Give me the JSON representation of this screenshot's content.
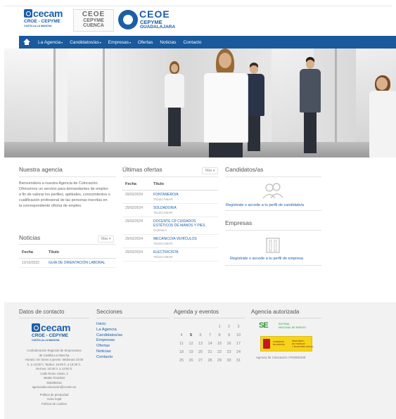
{
  "brand": {
    "cecam": {
      "name": "cecam",
      "line1": "CROE - CEPYME",
      "line2": "CASTILLA-LA MANCHA"
    },
    "cuenca": {
      "line1": "CEOE",
      "line2": "CEPYME",
      "line3": "CUENCA"
    },
    "guadalajara": {
      "line1": "CEOE",
      "line2": "CEPYME",
      "line3": "GUADALAJARA"
    }
  },
  "nav": {
    "home_icon": "home-icon",
    "items": [
      {
        "label": "La Agencia",
        "dropdown": true
      },
      {
        "label": "Candidatos/as",
        "dropdown": true
      },
      {
        "label": "Empresas",
        "dropdown": true
      },
      {
        "label": "Ofertas",
        "dropdown": false
      },
      {
        "label": "Noticias",
        "dropdown": false
      },
      {
        "label": "Contacto",
        "dropdown": false
      }
    ],
    "caret": "▾"
  },
  "agency": {
    "title": "Nuestra agencia",
    "text": "Bienvenido/a a nuestra Agencia de Colocación. Ofrecemos un servicio para demandantes de empleo a fin de valorar los perfiles, aptitudes, conocimientos o cualificación profesional de las personas inscritas en la correspondiente oficina de empleo."
  },
  "news": {
    "title": "Noticias",
    "more": "Más",
    "headers": [
      "Fecha",
      "Título"
    ],
    "rows": [
      {
        "date": "13/10/2022",
        "title": "GUÍA DE ORIENTACIÓN LABORAL"
      }
    ]
  },
  "offers": {
    "title": "Últimas ofertas",
    "more": "Más",
    "headers": [
      "Fecha",
      "Título"
    ],
    "rows": [
      {
        "date": "29/02/2024",
        "title": "FONTANERO/A",
        "location": "TELECAMAR"
      },
      {
        "date": "29/02/2024",
        "title": "SOLDADOR/A",
        "location": "TELECAMAR"
      },
      {
        "date": "29/02/2024",
        "title": "DOCENTE CP CUIDADOS ESTÉTICOS DE MANOS Y PIES",
        "location": "CUENCA"
      },
      {
        "date": "29/02/2024",
        "title": "MECÁNICO/A VEHÍCULOS",
        "location": "TELECAMAR"
      },
      {
        "date": "29/02/2024",
        "title": "ELECTRICISTA",
        "location": "TELECAMAR"
      }
    ]
  },
  "candidates": {
    "title": "Candidatos/as",
    "icon": "users-icon",
    "link": "Regístrate o  accede a tu perfil de candidato/a"
  },
  "companies": {
    "title": "Empresas",
    "icon": "building-icon",
    "link": "Regístrate o  accede a tu perfil de empresa"
  },
  "footer": {
    "contact": {
      "title": "Datos de contacto",
      "lines": [
        "Confederación Regional de Empresarios",
        "de Castilla-La Mancha",
        "Horario: De lunes a jueves: Mañanas 10:00",
        "h. a 13:00 h. Tardes: 16:00 h. a 18:30 h.",
        "Viernes: 10:00 h. a 13:00 h.",
        "Calle Reino Unido, 3",
        "45005 TOLEDO",
        "925285015",
        "agenciadecolocacion@cecam.es"
      ],
      "legal": [
        "Política de privacidad",
        "Aviso legal",
        "Política de cookies"
      ]
    },
    "sections": {
      "title": "Secciones",
      "items": [
        "Inicio",
        "La Agencia",
        "Candidatos/as",
        "Empresas",
        "Ofertas",
        "Noticias",
        "Contacto"
      ]
    },
    "agenda": {
      "title": "Agenda y eventos",
      "weeks": [
        [
          "",
          "",
          "",
          "",
          "1",
          "2",
          "3"
        ],
        [
          "4",
          "5",
          "6",
          "7",
          "8",
          "9",
          "10"
        ],
        [
          "11",
          "12",
          "13",
          "14",
          "15",
          "16",
          "17"
        ],
        [
          "18",
          "19",
          "20",
          "21",
          "22",
          "23",
          "24"
        ],
        [
          "25",
          "26",
          "27",
          "28",
          "29",
          "30",
          "31"
        ]
      ],
      "highlight": "5"
    },
    "authorized": {
      "title": "Agencia autorizada",
      "sne": {
        "mark": "SE",
        "line1": "SISTEMA",
        "line2": "NACIONAL DE EMPLEO"
      },
      "ministry": {
        "line1": "GOBIERNO",
        "line2": "DE ESPAÑA",
        "line3": "MINISTERIO",
        "line4": "DE TRABAJO",
        "line5": "Y ECONOMÍA SOCIAL"
      },
      "agency_id": "Agencia de Colocación: 0700000109"
    }
  },
  "colors": {
    "nav": "#19599c",
    "link": "#1a5ea8",
    "footer_bg": "#f2f2f2"
  }
}
